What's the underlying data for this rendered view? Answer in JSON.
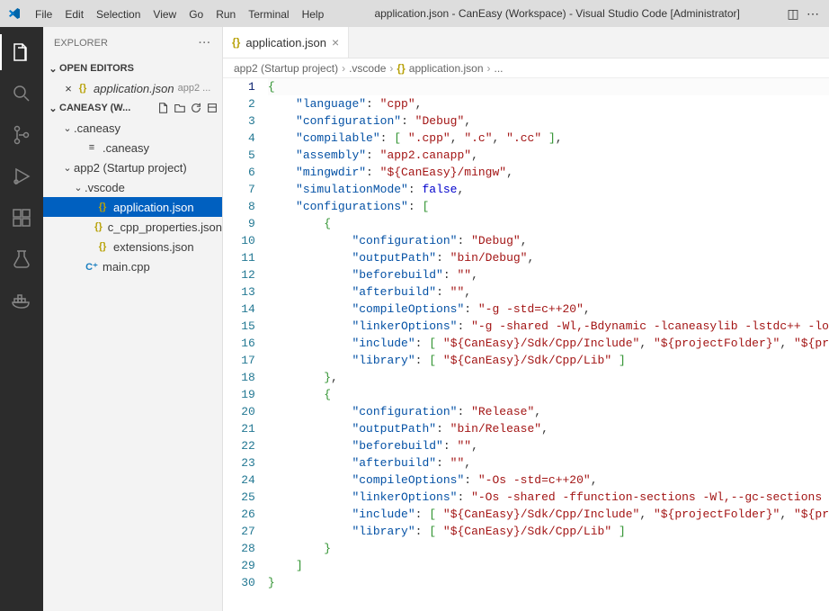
{
  "titlebar": {
    "menus": [
      "File",
      "Edit",
      "Selection",
      "View",
      "Go",
      "Run",
      "Terminal",
      "Help"
    ],
    "title": "application.json - CanEasy (Workspace) - Visual Studio Code [Administrator]"
  },
  "activity": {
    "items": [
      "files-icon",
      "search-icon",
      "source-control-icon",
      "run-debug-icon",
      "extensions-icon",
      "testing-icon",
      "docker-icon"
    ],
    "active": 0
  },
  "sidebar": {
    "title": "EXPLORER",
    "openEditors": {
      "label": "OPEN EDITORS",
      "items": [
        {
          "icon": "json-icon",
          "name": "application.json",
          "dim": "app2 ..."
        }
      ]
    },
    "workspace": {
      "label": "CANEASY (W...",
      "tree": [
        {
          "type": "folder",
          "name": ".caneasy",
          "open": true,
          "indent": 1
        },
        {
          "type": "file",
          "name": ".caneasy",
          "icon": "file-icon",
          "indent": 2
        },
        {
          "type": "folder",
          "name": "app2 (Startup project)",
          "open": true,
          "indent": 1
        },
        {
          "type": "folder",
          "name": ".vscode",
          "open": true,
          "indent": 2
        },
        {
          "type": "file",
          "name": "application.json",
          "icon": "json-icon",
          "indent": 3,
          "selected": true
        },
        {
          "type": "file",
          "name": "c_cpp_properties.json",
          "icon": "json-icon",
          "indent": 3
        },
        {
          "type": "file",
          "name": "extensions.json",
          "icon": "json-icon",
          "indent": 3
        },
        {
          "type": "file",
          "name": "main.cpp",
          "icon": "cpp-icon",
          "indent": 2
        }
      ]
    }
  },
  "tabs": [
    {
      "icon": "json-icon",
      "name": "application.json",
      "active": true
    }
  ],
  "breadcrumbs": [
    "app2 (Startup project)",
    ".vscode",
    "application.json",
    "..."
  ],
  "editor": {
    "activeLine": 1,
    "lines": [
      {
        "n": 1,
        "t": [
          [
            "brace",
            "{"
          ]
        ]
      },
      {
        "n": 2,
        "t": [
          [
            "",
            "    "
          ],
          [
            "key",
            "\"language\""
          ],
          [
            "punct",
            ": "
          ],
          [
            "string",
            "\"cpp\""
          ],
          [
            "punct",
            ","
          ]
        ]
      },
      {
        "n": 3,
        "t": [
          [
            "",
            "    "
          ],
          [
            "key",
            "\"configuration\""
          ],
          [
            "punct",
            ": "
          ],
          [
            "string",
            "\"Debug\""
          ],
          [
            "punct",
            ","
          ]
        ]
      },
      {
        "n": 4,
        "t": [
          [
            "",
            "    "
          ],
          [
            "key",
            "\"compilable\""
          ],
          [
            "punct",
            ": "
          ],
          [
            "brace",
            "["
          ],
          [
            "",
            " "
          ],
          [
            "string",
            "\".cpp\""
          ],
          [
            "punct",
            ", "
          ],
          [
            "string",
            "\".c\""
          ],
          [
            "punct",
            ", "
          ],
          [
            "string",
            "\".cc\""
          ],
          [
            "",
            " "
          ],
          [
            "brace",
            "]"
          ],
          [
            "punct",
            ","
          ]
        ]
      },
      {
        "n": 5,
        "t": [
          [
            "",
            "    "
          ],
          [
            "key",
            "\"assembly\""
          ],
          [
            "punct",
            ": "
          ],
          [
            "string",
            "\"app2.canapp\""
          ],
          [
            "punct",
            ","
          ]
        ]
      },
      {
        "n": 6,
        "t": [
          [
            "",
            "    "
          ],
          [
            "key",
            "\"mingwdir\""
          ],
          [
            "punct",
            ": "
          ],
          [
            "string",
            "\"${CanEasy}/mingw\""
          ],
          [
            "punct",
            ","
          ]
        ]
      },
      {
        "n": 7,
        "t": [
          [
            "",
            "    "
          ],
          [
            "key",
            "\"simulationMode\""
          ],
          [
            "punct",
            ": "
          ],
          [
            "keyword",
            "false"
          ],
          [
            "punct",
            ","
          ]
        ]
      },
      {
        "n": 8,
        "t": [
          [
            "",
            "    "
          ],
          [
            "key",
            "\"configurations\""
          ],
          [
            "punct",
            ": "
          ],
          [
            "brace",
            "["
          ]
        ]
      },
      {
        "n": 9,
        "t": [
          [
            "",
            "        "
          ],
          [
            "brace",
            "{"
          ]
        ]
      },
      {
        "n": 10,
        "t": [
          [
            "",
            "            "
          ],
          [
            "key",
            "\"configuration\""
          ],
          [
            "punct",
            ": "
          ],
          [
            "string",
            "\"Debug\""
          ],
          [
            "punct",
            ","
          ]
        ]
      },
      {
        "n": 11,
        "t": [
          [
            "",
            "            "
          ],
          [
            "key",
            "\"outputPath\""
          ],
          [
            "punct",
            ": "
          ],
          [
            "string",
            "\"bin/Debug\""
          ],
          [
            "punct",
            ","
          ]
        ]
      },
      {
        "n": 12,
        "t": [
          [
            "",
            "            "
          ],
          [
            "key",
            "\"beforebuild\""
          ],
          [
            "punct",
            ": "
          ],
          [
            "string",
            "\"\""
          ],
          [
            "punct",
            ","
          ]
        ]
      },
      {
        "n": 13,
        "t": [
          [
            "",
            "            "
          ],
          [
            "key",
            "\"afterbuild\""
          ],
          [
            "punct",
            ": "
          ],
          [
            "string",
            "\"\""
          ],
          [
            "punct",
            ","
          ]
        ]
      },
      {
        "n": 14,
        "t": [
          [
            "",
            "            "
          ],
          [
            "key",
            "\"compileOptions\""
          ],
          [
            "punct",
            ": "
          ],
          [
            "string",
            "\"-g -std=c++20\""
          ],
          [
            "punct",
            ","
          ]
        ]
      },
      {
        "n": 15,
        "t": [
          [
            "",
            "            "
          ],
          [
            "key",
            "\"linkerOptions\""
          ],
          [
            "punct",
            ": "
          ],
          [
            "string",
            "\"-g -shared -Wl,-Bdynamic -lcaneasylib -lstdc++ -lo"
          ]
        ]
      },
      {
        "n": 16,
        "t": [
          [
            "",
            "            "
          ],
          [
            "key",
            "\"include\""
          ],
          [
            "punct",
            ": "
          ],
          [
            "brace",
            "["
          ],
          [
            "",
            " "
          ],
          [
            "string",
            "\"${CanEasy}/Sdk/Cpp/Include\""
          ],
          [
            "punct",
            ", "
          ],
          [
            "string",
            "\"${projectFolder}\""
          ],
          [
            "punct",
            ", "
          ],
          [
            "string",
            "\"${pr"
          ]
        ]
      },
      {
        "n": 17,
        "t": [
          [
            "",
            "            "
          ],
          [
            "key",
            "\"library\""
          ],
          [
            "punct",
            ": "
          ],
          [
            "brace",
            "["
          ],
          [
            "",
            " "
          ],
          [
            "string",
            "\"${CanEasy}/Sdk/Cpp/Lib\""
          ],
          [
            "",
            " "
          ],
          [
            "brace",
            "]"
          ]
        ]
      },
      {
        "n": 18,
        "t": [
          [
            "",
            "        "
          ],
          [
            "brace",
            "}"
          ],
          [
            "punct",
            ","
          ]
        ]
      },
      {
        "n": 19,
        "t": [
          [
            "",
            "        "
          ],
          [
            "brace",
            "{"
          ]
        ]
      },
      {
        "n": 20,
        "t": [
          [
            "",
            "            "
          ],
          [
            "key",
            "\"configuration\""
          ],
          [
            "punct",
            ": "
          ],
          [
            "string",
            "\"Release\""
          ],
          [
            "punct",
            ","
          ]
        ]
      },
      {
        "n": 21,
        "t": [
          [
            "",
            "            "
          ],
          [
            "key",
            "\"outputPath\""
          ],
          [
            "punct",
            ": "
          ],
          [
            "string",
            "\"bin/Release\""
          ],
          [
            "punct",
            ","
          ]
        ]
      },
      {
        "n": 22,
        "t": [
          [
            "",
            "            "
          ],
          [
            "key",
            "\"beforebuild\""
          ],
          [
            "punct",
            ": "
          ],
          [
            "string",
            "\"\""
          ],
          [
            "punct",
            ","
          ]
        ]
      },
      {
        "n": 23,
        "t": [
          [
            "",
            "            "
          ],
          [
            "key",
            "\"afterbuild\""
          ],
          [
            "punct",
            ": "
          ],
          [
            "string",
            "\"\""
          ],
          [
            "punct",
            ","
          ]
        ]
      },
      {
        "n": 24,
        "t": [
          [
            "",
            "            "
          ],
          [
            "key",
            "\"compileOptions\""
          ],
          [
            "punct",
            ": "
          ],
          [
            "string",
            "\"-Os -std=c++20\""
          ],
          [
            "punct",
            ","
          ]
        ]
      },
      {
        "n": 25,
        "t": [
          [
            "",
            "            "
          ],
          [
            "key",
            "\"linkerOptions\""
          ],
          [
            "punct",
            ": "
          ],
          [
            "string",
            "\"-Os -shared -ffunction-sections -Wl,--gc-sections "
          ]
        ]
      },
      {
        "n": 26,
        "t": [
          [
            "",
            "            "
          ],
          [
            "key",
            "\"include\""
          ],
          [
            "punct",
            ": "
          ],
          [
            "brace",
            "["
          ],
          [
            "",
            " "
          ],
          [
            "string",
            "\"${CanEasy}/Sdk/Cpp/Include\""
          ],
          [
            "punct",
            ", "
          ],
          [
            "string",
            "\"${projectFolder}\""
          ],
          [
            "punct",
            ", "
          ],
          [
            "string",
            "\"${pr"
          ]
        ]
      },
      {
        "n": 27,
        "t": [
          [
            "",
            "            "
          ],
          [
            "key",
            "\"library\""
          ],
          [
            "punct",
            ": "
          ],
          [
            "brace",
            "["
          ],
          [
            "",
            " "
          ],
          [
            "string",
            "\"${CanEasy}/Sdk/Cpp/Lib\""
          ],
          [
            "",
            " "
          ],
          [
            "brace",
            "]"
          ]
        ]
      },
      {
        "n": 28,
        "t": [
          [
            "",
            "        "
          ],
          [
            "brace",
            "}"
          ]
        ]
      },
      {
        "n": 29,
        "t": [
          [
            "",
            "    "
          ],
          [
            "brace",
            "]"
          ]
        ]
      },
      {
        "n": 30,
        "t": [
          [
            "brace",
            "}"
          ]
        ]
      }
    ]
  }
}
